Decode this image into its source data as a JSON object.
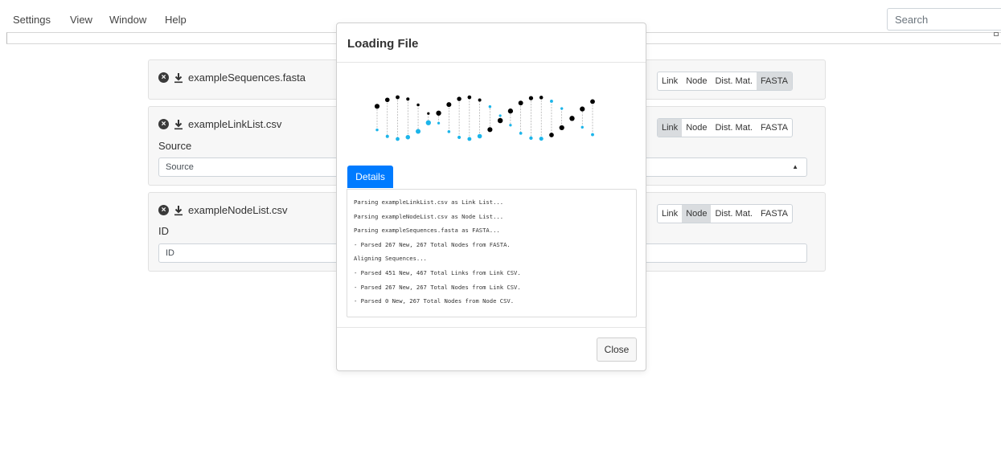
{
  "menu": {
    "items": [
      "Settings",
      "View",
      "Window",
      "Help"
    ],
    "search_placeholder": "Search"
  },
  "cards": [
    {
      "filename": "exampleSequences.fasta",
      "types": [
        "Link",
        "Node",
        "Dist. Mat.",
        "FASTA"
      ],
      "active_type": "FASTA"
    },
    {
      "filename": "exampleLinkList.csv",
      "field_label": "Source",
      "field_value": "Source",
      "types": [
        "Link",
        "Node",
        "Dist. Mat.",
        "FASTA"
      ],
      "active_type": "Link"
    },
    {
      "filename": "exampleNodeList.csv",
      "field_label": "ID",
      "field_value": "ID",
      "types": [
        "Link",
        "Node",
        "Dist. Mat.",
        "FASTA"
      ],
      "active_type": "Node"
    }
  ],
  "modal": {
    "title": "Loading File",
    "details_label": "Details",
    "close_label": "Close",
    "log": [
      "Parsing exampleLinkList.csv as Link List...",
      "Parsing exampleNodeList.csv as Node List...",
      "Parsing exampleSequences.fasta as FASTA...",
      "- Parsed 267 New, 267 Total Nodes from FASTA.",
      "Aligning Sequences...",
      "- Parsed 451 New, 467 Total Links from Link CSV.",
      "- Parsed 267 New, 267 Total Nodes from Link CSV.",
      "- Parsed 0 New, 267 Total Nodes from Node CSV."
    ]
  },
  "colors": {
    "accent": "#007bff",
    "helix_blue": "#1cb5ea",
    "helix_black": "#000000"
  }
}
